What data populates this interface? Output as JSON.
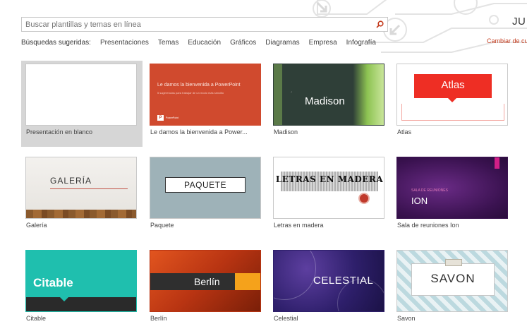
{
  "search": {
    "placeholder": "Buscar plantillas y temas en línea",
    "value": ""
  },
  "user": {
    "initials": "JU",
    "change_link": "Cambiar de cu"
  },
  "suggested": {
    "label": "Búsquedas sugeridas:",
    "links": [
      "Presentaciones",
      "Temas",
      "Educación",
      "Gráficos",
      "Diagramas",
      "Empresa",
      "Infografía"
    ]
  },
  "templates": [
    {
      "label": "Presentación en blanco"
    },
    {
      "label": "Le damos la bienvenida a Power...",
      "thumb_title": "Le damos la bienvenida a PowerPoint",
      "thumb_sub": "5 sugerencias para trabajar de un modo más sencillo",
      "thumb_brand": "PowerPoint",
      "thumb_logo": "P"
    },
    {
      "label": "Madison",
      "thumb_title": "Madison"
    },
    {
      "label": "Atlas",
      "thumb_title": "Atlas"
    },
    {
      "label": "Galería",
      "thumb_title": "GALERÍA"
    },
    {
      "label": "Paquete",
      "thumb_title": "PAQUETE"
    },
    {
      "label": "Letras en madera",
      "thumb_title": "LETRAS EN MADERA"
    },
    {
      "label": "Sala de reuniones Ion",
      "thumb_title": "ION",
      "thumb_sub": "SALA DE REUNIONES"
    },
    {
      "label": "Citable",
      "thumb_title": "Citable"
    },
    {
      "label": "Berlín",
      "thumb_title": "Berlín"
    },
    {
      "label": "Celestial",
      "thumb_title": "CELESTIAL"
    },
    {
      "label": "Savon",
      "thumb_title": "SAVON"
    }
  ],
  "colors": {
    "accent_link": "#c43b1d",
    "search_icon": "#c43b1d"
  }
}
